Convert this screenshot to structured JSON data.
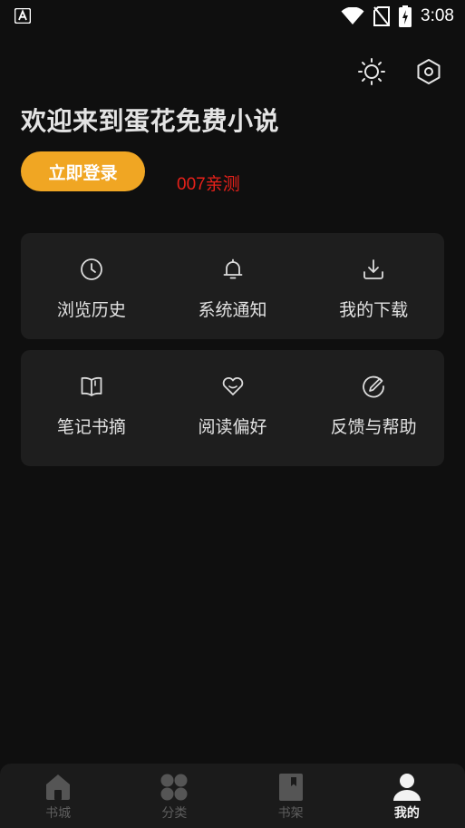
{
  "status_bar": {
    "time": "3:08"
  },
  "header": {
    "welcome": "欢迎来到蛋花免费小说",
    "login_button": "立即登录",
    "promo_text": "007亲测",
    "icons": [
      "sun-icon",
      "settings-hexagon-icon"
    ]
  },
  "menu_rows": [
    [
      {
        "label": "浏览历史",
        "icon": "clock-icon"
      },
      {
        "label": "系统通知",
        "icon": "bell-icon"
      },
      {
        "label": "我的下载",
        "icon": "download-icon"
      }
    ],
    [
      {
        "label": "笔记书摘",
        "icon": "book-open-icon"
      },
      {
        "label": "阅读偏好",
        "icon": "heart-icon"
      },
      {
        "label": "反馈与帮助",
        "icon": "edit-icon"
      }
    ]
  ],
  "bottom_nav": {
    "items": [
      {
        "label": "书城",
        "icon": "home-icon"
      },
      {
        "label": "分类",
        "icon": "category-icon"
      },
      {
        "label": "书架",
        "icon": "bookshelf-icon"
      },
      {
        "label": "我的",
        "icon": "profile-icon"
      }
    ],
    "active": "我的"
  },
  "colors": {
    "background": "#0f0f0f",
    "card": "#1e1e1e",
    "accent": "#f0a623",
    "promo": "#e8211a"
  }
}
